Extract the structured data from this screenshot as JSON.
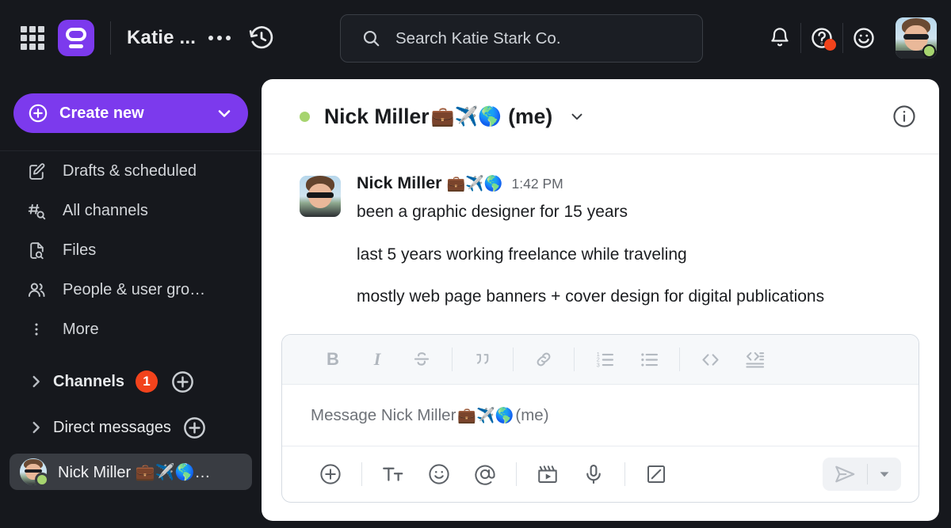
{
  "topbar": {
    "apps_icon": "grid-apps-icon",
    "workspace_logo_icon": "workspace-logo-icon",
    "workspace_name": "Katie ...",
    "more_menu_icon": "ellipsis-icon",
    "history_icon": "history-clock-icon",
    "search": {
      "placeholder": "Search Katie Stark Co.",
      "value": "",
      "icon": "search-icon"
    },
    "notifications_icon": "bell-icon",
    "help_icon": "help-question-icon",
    "help_badge": true,
    "emoji_status_icon": "smiley-face-icon",
    "user_avatar": "user-avatar",
    "user_presence": "active"
  },
  "sidebar": {
    "create_new": {
      "label": "Create new",
      "plus_icon": "plus-circle-icon",
      "caret_icon": "chevron-down-icon"
    },
    "nav_items": [
      {
        "label": "Drafts & scheduled",
        "icon": "drafts-pencil-icon"
      },
      {
        "label": "All channels",
        "icon": "hash-search-icon"
      },
      {
        "label": "Files",
        "icon": "file-search-icon"
      },
      {
        "label": "People & user gro…",
        "icon": "people-icon"
      },
      {
        "label": "More",
        "icon": "more-vertical-icon"
      }
    ],
    "sections": [
      {
        "label": "Channels",
        "badge": "1",
        "chevron_icon": "chevron-right-icon",
        "add_icon": "plus-circle-icon"
      },
      {
        "label": "Direct messages",
        "badge": "",
        "chevron_icon": "chevron-right-icon",
        "add_icon": "plus-circle-icon"
      }
    ],
    "dm": {
      "name": "Nick Miller 💼✈️🌎…",
      "presence": "active",
      "avatar": "nick-miller-avatar"
    }
  },
  "conversation": {
    "header": {
      "presence": "active",
      "title_name": "Nick Miller",
      "title_emoji": "💼✈️🌎",
      "title_suffix": "(me)",
      "caret_icon": "chevron-down-icon",
      "info_icon": "info-circle-icon"
    },
    "message": {
      "avatar": "nick-miller-avatar",
      "author": "Nick Miller",
      "author_emoji": "💼✈️🌎",
      "time": "1:42 PM",
      "lines": [
        "been a graphic designer for 15 years",
        "last 5 years working freelance while traveling",
        "mostly web page banners + cover design for digital publications"
      ]
    }
  },
  "composer": {
    "format_buttons": [
      {
        "name": "bold",
        "label": "B",
        "icon": "bold-icon"
      },
      {
        "name": "italic",
        "label": "I",
        "icon": "italic-icon"
      },
      {
        "name": "strikethrough",
        "label": "S",
        "icon": "strikethrough-icon"
      },
      {
        "name": "blockquote",
        "label": "",
        "icon": "blockquote-icon"
      },
      {
        "name": "link",
        "label": "",
        "icon": "link-icon"
      },
      {
        "name": "ordered-list",
        "label": "",
        "icon": "ordered-list-icon"
      },
      {
        "name": "bulleted-list",
        "label": "",
        "icon": "bulleted-list-icon"
      },
      {
        "name": "code",
        "label": "",
        "icon": "code-icon"
      },
      {
        "name": "code-block",
        "label": "",
        "icon": "code-block-icon"
      }
    ],
    "input": {
      "placeholder_prefix": "Message Nick Miller ",
      "placeholder_emoji": "💼✈️🌎",
      "placeholder_suffix": " (me)",
      "value": ""
    },
    "action_buttons": [
      {
        "name": "attach",
        "icon": "plus-circle-icon"
      },
      {
        "name": "formatting",
        "icon": "text-format-icon"
      },
      {
        "name": "emoji",
        "icon": "smiley-face-icon"
      },
      {
        "name": "mention",
        "icon": "at-mention-icon"
      },
      {
        "name": "video-clip",
        "icon": "video-clip-icon"
      },
      {
        "name": "audio-clip",
        "icon": "microphone-icon"
      },
      {
        "name": "canvas",
        "icon": "canvas-icon"
      }
    ],
    "send": {
      "icon": "send-arrow-icon",
      "caret_icon": "chevron-down-icon"
    }
  },
  "colors": {
    "brand_purple": "#7c3aed",
    "sidebar_bg": "#16181d",
    "badge_orange": "#f2431c",
    "presence_green": "#a6d46f",
    "panel_bg": "#ffffff"
  }
}
